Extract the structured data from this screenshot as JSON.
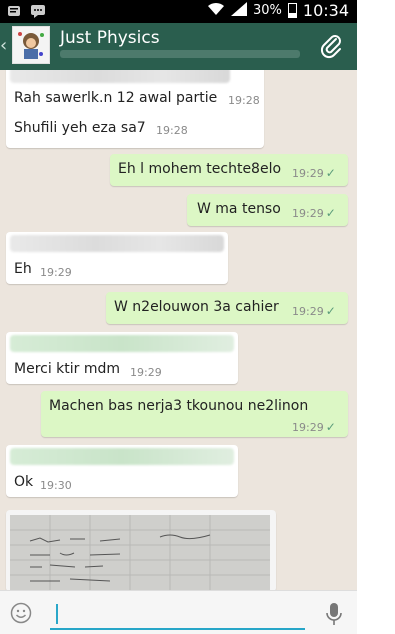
{
  "status": {
    "battery": "30%",
    "time": "10:34",
    "battery_level": 0.3
  },
  "header": {
    "title": "Just Physics"
  },
  "messages": [
    {
      "dir": "in",
      "text": "Rah sawerlk.n 12 awal partie",
      "time": "19:28"
    },
    {
      "dir": "in",
      "text": "Shufili yeh eza sa7",
      "time": "19:28"
    },
    {
      "dir": "out",
      "text": "Eh l mohem techte8elo",
      "time": "19:29"
    },
    {
      "dir": "out",
      "text": "W ma tenso",
      "time": "19:29"
    },
    {
      "dir": "in",
      "text": "Eh",
      "time": "19:29"
    },
    {
      "dir": "out",
      "text": "W n2elouwon 3a cahier",
      "time": "19:29"
    },
    {
      "dir": "in",
      "text": "Merci ktir mdm",
      "time": "19:29"
    },
    {
      "dir": "out",
      "text": "Machen bas nerja3 tkounou ne2linon",
      "time": "19:29"
    },
    {
      "dir": "in",
      "text": "Ok",
      "time": "19:30"
    }
  ],
  "icons": {
    "back": "‹",
    "check": "✓"
  },
  "colors": {
    "appbar": "#2a5e4e",
    "chat_bg": "#ece5dd",
    "outgoing": "#dcf7c5",
    "incoming": "#ffffff",
    "accent": "#27a6c8"
  }
}
